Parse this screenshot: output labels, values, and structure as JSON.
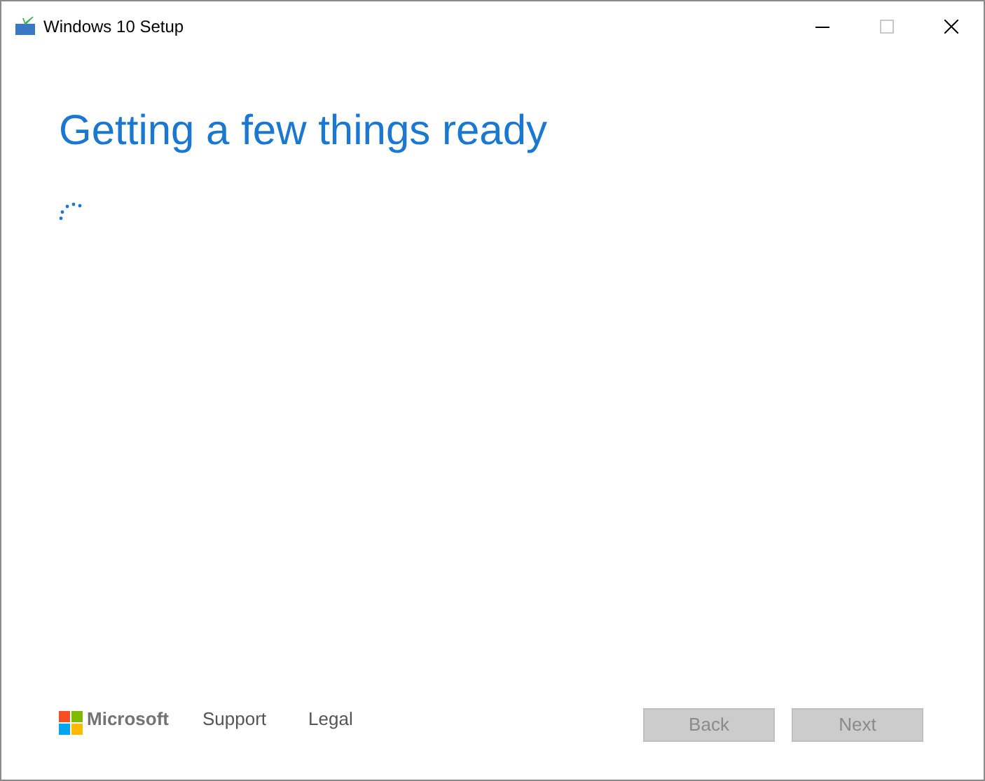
{
  "window": {
    "title": "Windows 10 Setup"
  },
  "heading": "Getting a few things ready",
  "footer": {
    "brand": "Microsoft",
    "links": [
      "Support",
      "Legal"
    ]
  },
  "buttons": [
    {
      "label": "Back",
      "disabled": true
    },
    {
      "label": "Next",
      "disabled": true
    }
  ]
}
